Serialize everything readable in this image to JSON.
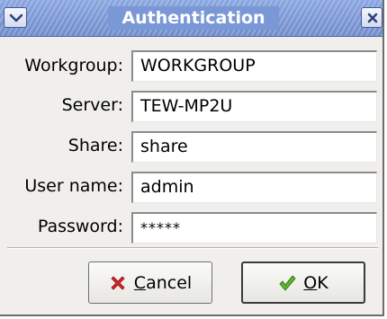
{
  "window": {
    "title": "Authentication",
    "menu_icon": "chevron-down-icon",
    "close_icon": "close-icon"
  },
  "form": {
    "workgroup": {
      "label": "Workgroup:",
      "value": "WORKGROUP"
    },
    "server": {
      "label": "Server:",
      "value": "TEW-MP2U"
    },
    "share": {
      "label": "Share:",
      "value": "share"
    },
    "username": {
      "label": "User name:",
      "value": "admin"
    },
    "password": {
      "label": "Password:",
      "value": "*****"
    }
  },
  "buttons": {
    "cancel": {
      "mnemonic": "C",
      "rest": "ancel",
      "icon": "red-x-icon"
    },
    "ok": {
      "mnemonic": "O",
      "rest": "K",
      "icon": "green-checkmark-icon"
    }
  },
  "colors": {
    "titlebar": "#7b98d6",
    "cancel_icon": "#d6262b",
    "ok_icon": "#5fb42e"
  }
}
